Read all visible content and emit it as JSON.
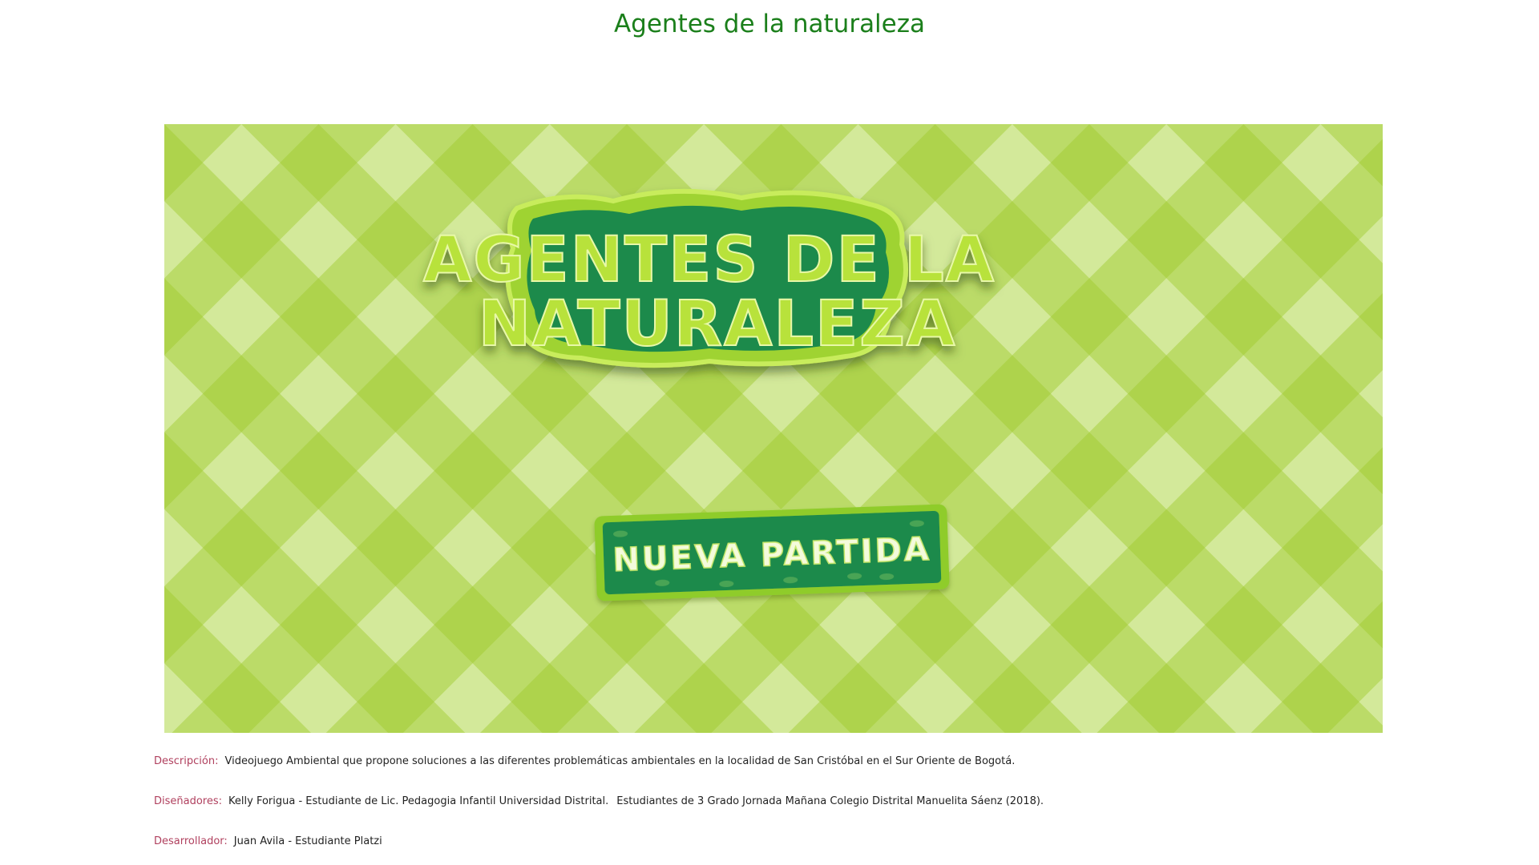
{
  "page": {
    "title": "Agentes de la naturaleza"
  },
  "game": {
    "logo_line1": "AGENTES DE LA",
    "logo_line2": "NATURALEZA",
    "start_button_label": "NUEVA PARTIDA",
    "colors": {
      "pattern_light": "#d3e99a",
      "pattern_mid": "#bfe070",
      "pattern_dark": "#9dcb2b",
      "badge_green": "#1f8a4c",
      "badge_border": "#8fcc2a",
      "logo_text": "#b8e23b"
    }
  },
  "info": {
    "description": {
      "label": "Descripción:",
      "value": "Videojuego Ambiental que propone soluciones a las diferentes problemáticas ambientales en la localidad de San Cristóbal en el Sur Oriente de Bogotá."
    },
    "designers": {
      "label": "Diseñadores:",
      "value": "Kelly Forigua - Estudiante de Lic. Pedagogia Infantil Universidad Distrital.",
      "value2": "Estudiantes de 3 Grado Jornada Mañana Colegio Distrital Manuelita Sáenz (2018)."
    },
    "developer": {
      "label": "Desarrollador:",
      "value": "Juan Avila - Estudiante Platzi"
    }
  }
}
